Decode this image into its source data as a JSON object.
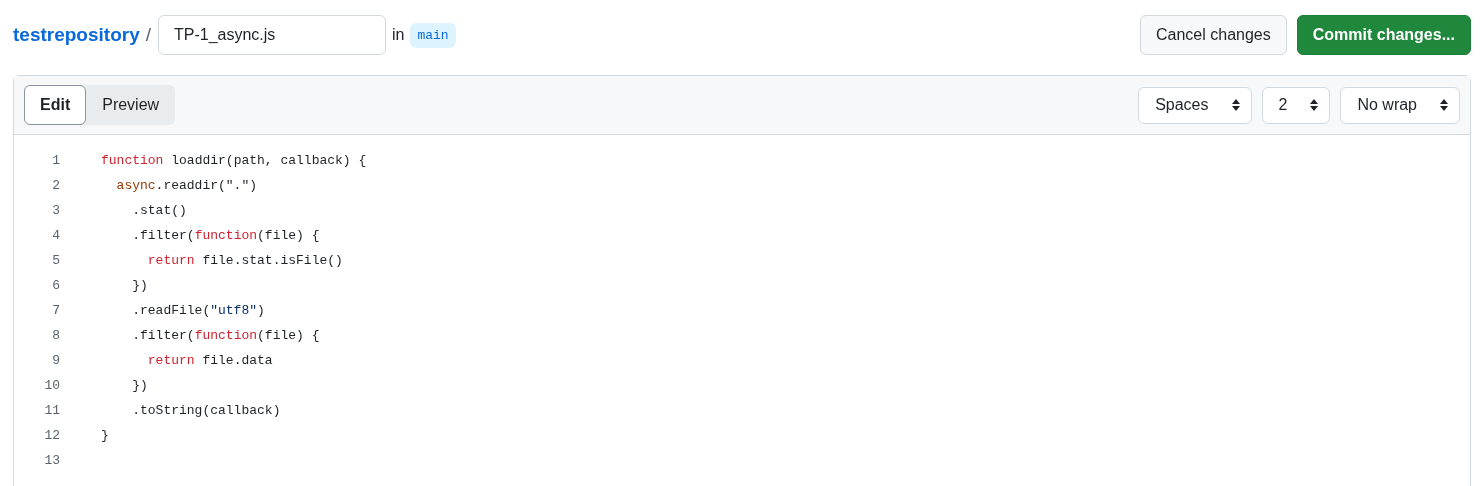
{
  "breadcrumb": {
    "repository": "testrepository",
    "separator": "/",
    "filename": "TP-1_async.js",
    "in_label": "in",
    "branch": "main"
  },
  "buttons": [
    {
      "label": "Cancel changes",
      "kind": "secondary"
    },
    {
      "label": "Commit changes...",
      "kind": "primary"
    }
  ],
  "tabs": [
    {
      "label": "Edit",
      "selected": true
    },
    {
      "label": "Preview",
      "selected": false
    }
  ],
  "selects": [
    {
      "value": "Spaces"
    },
    {
      "value": "2"
    },
    {
      "value": "No wrap"
    }
  ],
  "code_lines": [
    {
      "number": "1",
      "tokens": [
        {
          "kind": "keyword",
          "text": "function"
        },
        {
          "kind": "plain",
          "text": " loaddir(path, callback) {"
        }
      ]
    },
    {
      "number": "2",
      "tokens": [
        {
          "kind": "builtin",
          "text": "  async"
        },
        {
          "kind": "plain",
          "text": ".readdir(\".\")"
        }
      ]
    },
    {
      "number": "3",
      "tokens": [
        {
          "kind": "plain",
          "text": "    .stat()"
        }
      ]
    },
    {
      "number": "4",
      "tokens": [
        {
          "kind": "plain",
          "text": "    .filter("
        },
        {
          "kind": "keyword",
          "text": "function"
        },
        {
          "kind": "plain",
          "text": "(file) {"
        }
      ]
    },
    {
      "number": "5",
      "tokens": [
        {
          "kind": "keyword",
          "text": "      return"
        },
        {
          "kind": "plain",
          "text": " file.stat.isFile()"
        }
      ]
    },
    {
      "number": "6",
      "tokens": [
        {
          "kind": "plain",
          "text": "    })"
        }
      ]
    },
    {
      "number": "7",
      "tokens": [
        {
          "kind": "plain",
          "text": "    .readFile("
        },
        {
          "kind": "string",
          "text": "\"utf8\""
        },
        {
          "kind": "plain",
          "text": ")"
        }
      ]
    },
    {
      "number": "8",
      "tokens": [
        {
          "kind": "plain",
          "text": "    .filter("
        },
        {
          "kind": "keyword",
          "text": "function"
        },
        {
          "kind": "plain",
          "text": "(file) {"
        }
      ]
    },
    {
      "number": "9",
      "tokens": [
        {
          "kind": "keyword",
          "text": "      return"
        },
        {
          "kind": "plain",
          "text": " file.data"
        }
      ]
    },
    {
      "number": "10",
      "tokens": [
        {
          "kind": "plain",
          "text": "    })"
        }
      ]
    },
    {
      "number": "11",
      "tokens": [
        {
          "kind": "plain",
          "text": "    .toString(callback)"
        }
      ]
    },
    {
      "number": "12",
      "tokens": [
        {
          "kind": "plain",
          "text": "}"
        }
      ]
    },
    {
      "number": "13"
    }
  ]
}
